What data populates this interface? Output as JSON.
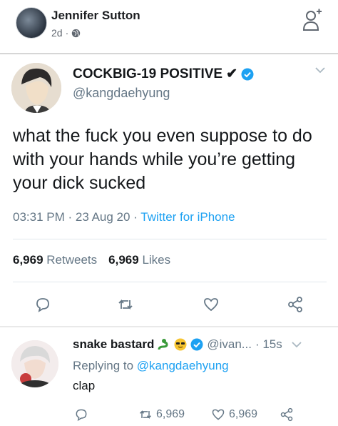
{
  "facebook_post": {
    "author_name": "Jennifer Sutton",
    "time_ago": "2d",
    "dot": "·"
  },
  "tweet": {
    "display_name": "COCKBIG-19 POSITIVE",
    "check_mark": "✔",
    "handle": "@kangdaehyung",
    "body": "what the fuck you even suppose to do with your hands while you’re getting your dick sucked",
    "timestamp": "03:31 PM · 23 Aug 20 · ",
    "source": "Twitter for iPhone",
    "retweets_count": "6,969",
    "retweets_label": "Retweets",
    "likes_count": "6,969",
    "likes_label": "Likes"
  },
  "reply": {
    "display_name": "snake bastard",
    "handle": "@ivan...",
    "time": "· 15s",
    "replying_prefix": "Replying to",
    "replying_handle": "@kangdaehyung",
    "text": "clap",
    "retweet_count": "6,969",
    "like_count": "6,969"
  },
  "colors": {
    "twitter_blue": "#1da1f2",
    "secondary_text": "#657786",
    "verified_blue": "#1da1f2"
  }
}
